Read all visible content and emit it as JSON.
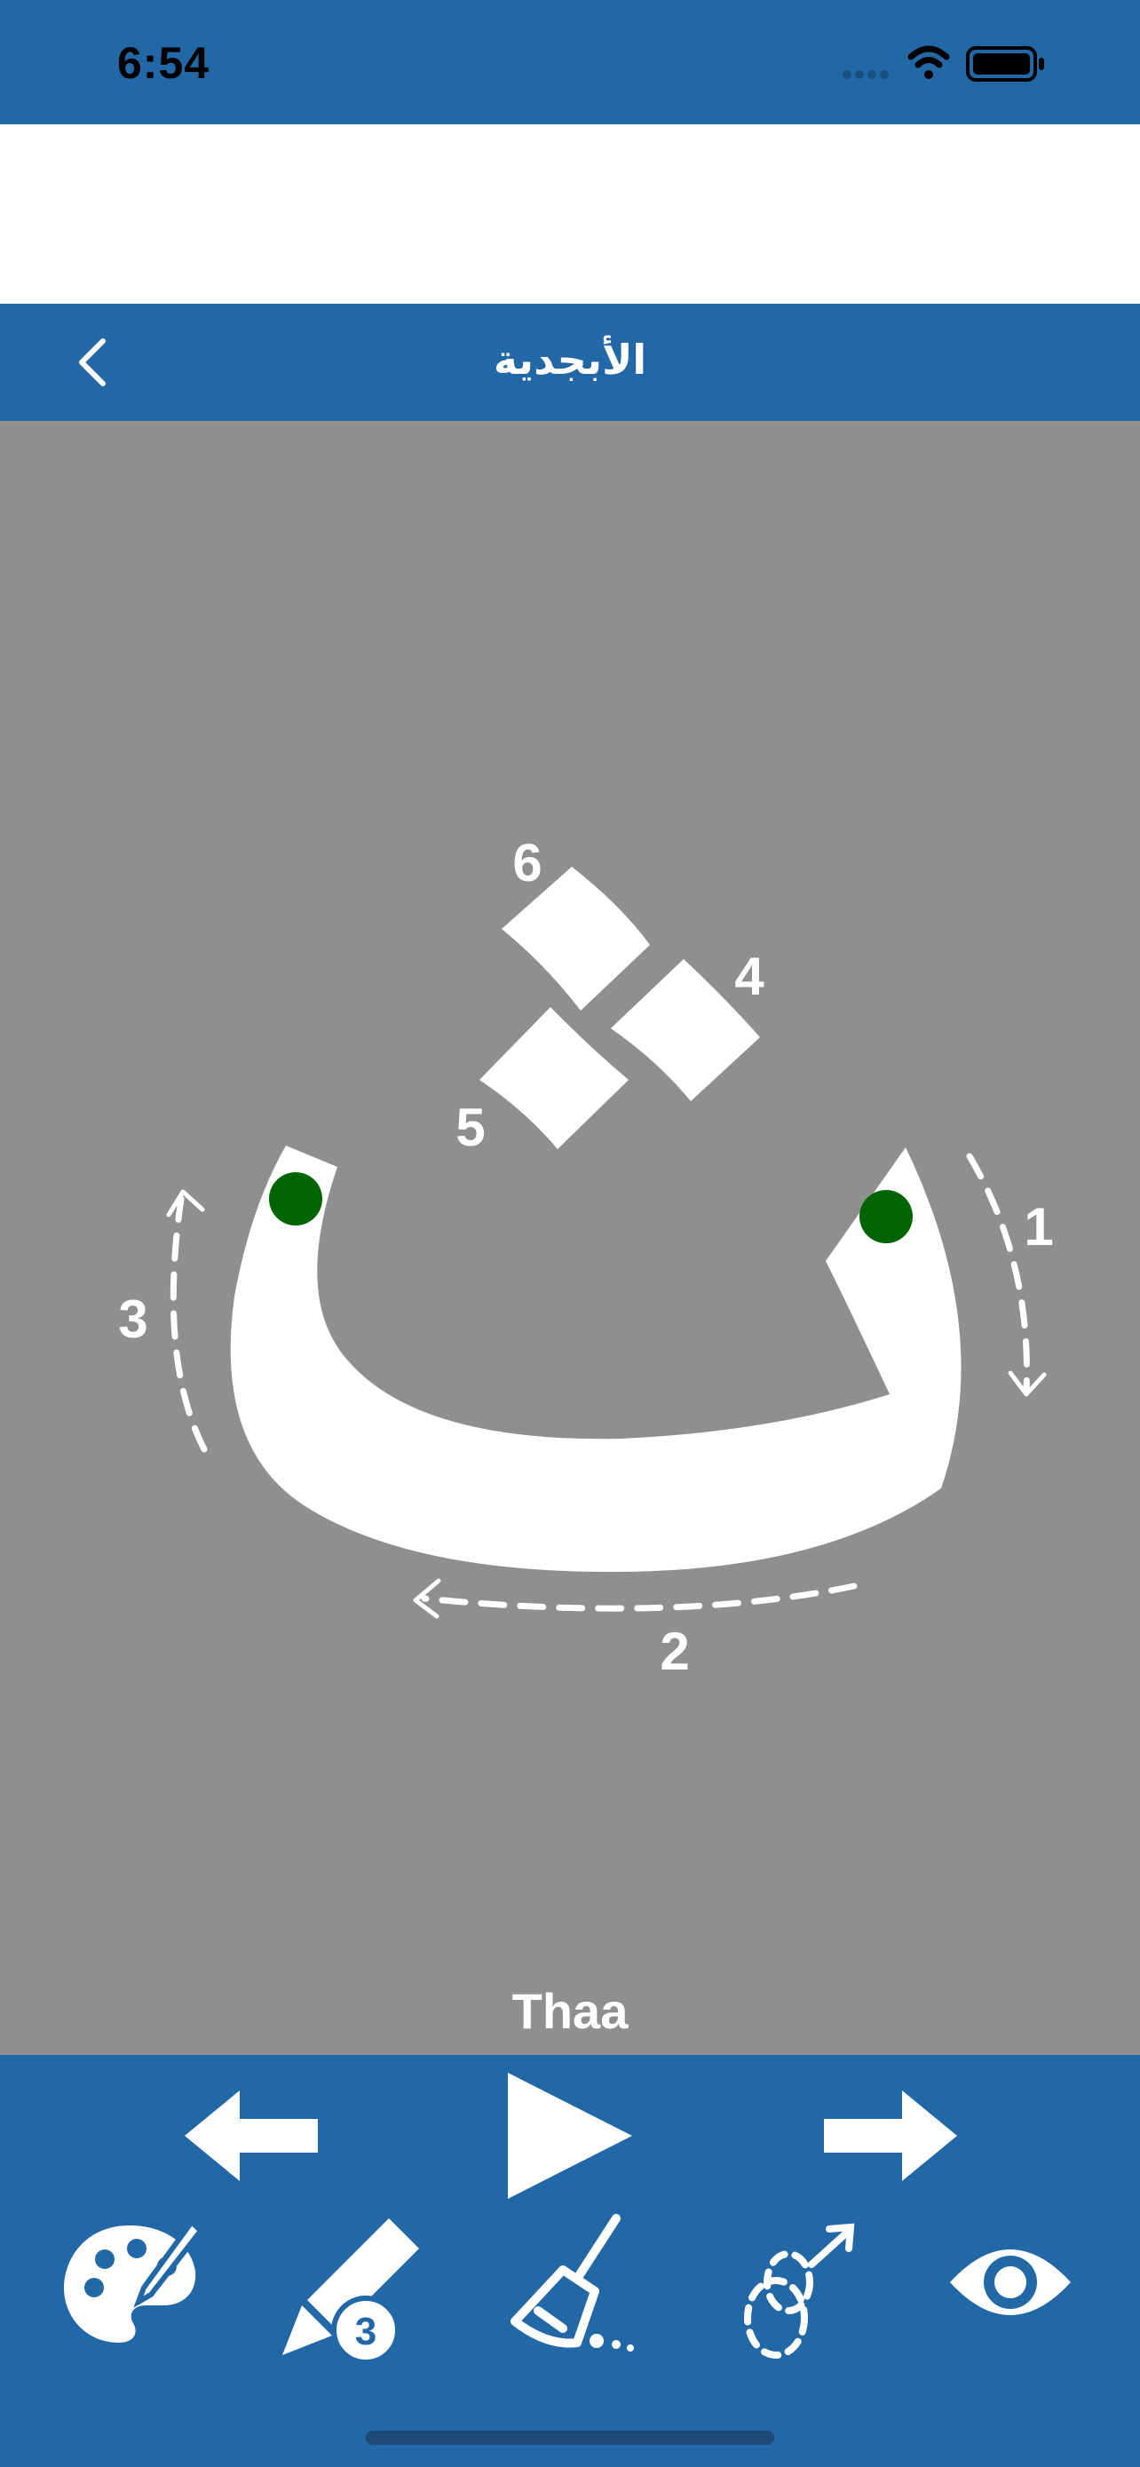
{
  "status_bar": {
    "time": "6:54",
    "signal_icon": "signal-dots-icon",
    "wifi_icon": "wifi-icon",
    "battery_icon": "battery-icon"
  },
  "nav": {
    "title": "الأبجدية",
    "back_icon": "chevron-left-icon"
  },
  "letter": {
    "name": "Thaa",
    "stroke_numbers": [
      "1",
      "2",
      "3",
      "4",
      "5",
      "6"
    ],
    "start_dot_color": "#006400"
  },
  "toolbar": {
    "row1": [
      "arrow-left-icon",
      "play-icon",
      "arrow-right-icon"
    ],
    "row2": [
      "palette-icon",
      "pencil-3-icon",
      "broom-icon",
      "trace-path-icon",
      "eye-icon"
    ],
    "pencil_badge": "3"
  },
  "colors": {
    "bar_blue": "#2368a6",
    "canvas_gray": "#8f8f8f",
    "letter_white": "#ffffff",
    "dot_green": "#006400"
  }
}
